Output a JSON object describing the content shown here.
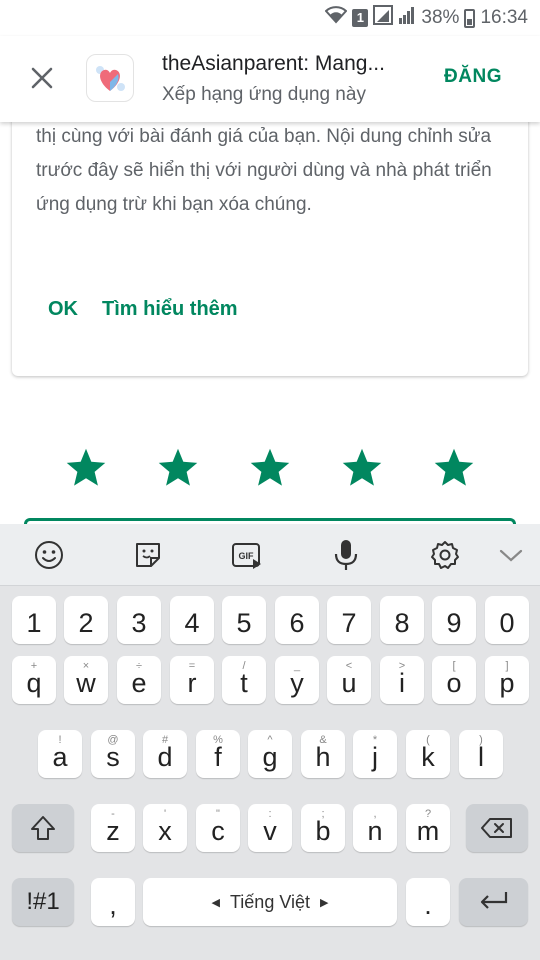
{
  "status_bar": {
    "sim_slot": "1",
    "battery_percent": "38%",
    "time": "16:34"
  },
  "header": {
    "app_name": "theAsianparent: Mang...",
    "subtitle": "Xếp hạng ứng dụng này",
    "post_label": "ĐĂNG"
  },
  "card": {
    "body_text": "thị cùng với bài đánh giá của bạn. Nội dung chỉnh sửa trước đây sẽ hiển thị với người dùng và nhà phát triển ứng dụng trừ khi bạn xóa chúng.",
    "ok_label": "OK",
    "learn_more_label": "Tìm hiểu thêm"
  },
  "rating": {
    "stars_filled": 5,
    "stars_total": 5,
    "star_color": "#01875f"
  },
  "colors": {
    "accent": "#01875f"
  },
  "keyboard": {
    "toolbar_icons": [
      "emoji-icon",
      "sticker-icon",
      "gif-icon",
      "microphone-icon",
      "settings-icon",
      "chevron-down-icon"
    ],
    "gif_label": "GIF",
    "number_row": [
      "1",
      "2",
      "3",
      "4",
      "5",
      "6",
      "7",
      "8",
      "9",
      "0"
    ],
    "row1": {
      "keys": [
        "q",
        "w",
        "e",
        "r",
        "t",
        "y",
        "u",
        "i",
        "o",
        "p"
      ],
      "hints": [
        "+",
        "×",
        "÷",
        "=",
        "/",
        "_",
        "<",
        ">",
        "[",
        "]"
      ]
    },
    "row2": {
      "keys": [
        "a",
        "s",
        "d",
        "f",
        "g",
        "h",
        "j",
        "k",
        "l"
      ],
      "hints": [
        "!",
        "@",
        "#",
        "%",
        "^",
        "&",
        "*",
        "(",
        ")"
      ]
    },
    "row3": {
      "keys": [
        "z",
        "x",
        "c",
        "v",
        "b",
        "n",
        "m"
      ],
      "hints": [
        "-",
        "'",
        "\"",
        ":",
        ";",
        ",",
        "?"
      ]
    },
    "symbols_label": "!#1",
    "comma_label": ",",
    "space_label": "Tiếng Việt",
    "period_label": "."
  }
}
